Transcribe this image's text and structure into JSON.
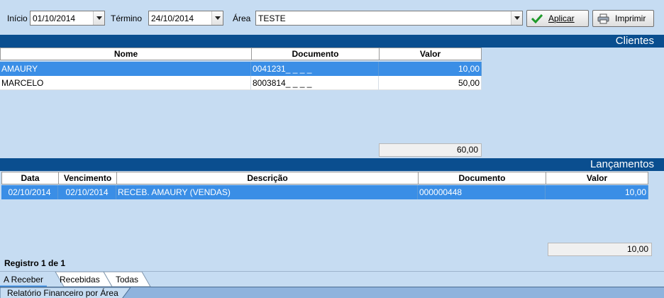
{
  "toolbar": {
    "inicio_label": "Início",
    "inicio_value": "01/10/2014",
    "termino_label": "Término",
    "termino_value": "24/10/2014",
    "area_label": "Área",
    "area_value": "TESTE",
    "aplicar_label": "Aplicar",
    "imprimir_label": "Imprimir"
  },
  "clientes": {
    "title": "Clientes",
    "columns": [
      "Nome",
      "Documento",
      "Valor"
    ],
    "rows": [
      {
        "nome": "AMAURY",
        "documento": "0041231_ _ _ _",
        "valor": "10,00"
      },
      {
        "nome": "MARCELO",
        "documento": "8003814_ _ _ _",
        "valor": "50,00"
      }
    ],
    "total": "60,00"
  },
  "lancamentos": {
    "title": "Lançamentos",
    "columns": [
      "Data",
      "Vencimento",
      "Descrição",
      "Documento",
      "Valor"
    ],
    "rows": [
      {
        "data": "02/10/2014",
        "vencimento": "02/10/2014",
        "descricao": "RECEB. AMAURY (VENDAS)",
        "documento": "000000448",
        "valor": "10,00"
      }
    ],
    "total": "10,00"
  },
  "registro": "Registro 1 de 1",
  "tabs": [
    "A Receber",
    "Recebidas",
    "Todas"
  ],
  "status": {
    "window_tab": "Relatório Financeiro por Área"
  },
  "colors": {
    "header_blue": "#0a4e8f",
    "selected_row": "#3a8ee6",
    "background": "#c6dcf2"
  }
}
